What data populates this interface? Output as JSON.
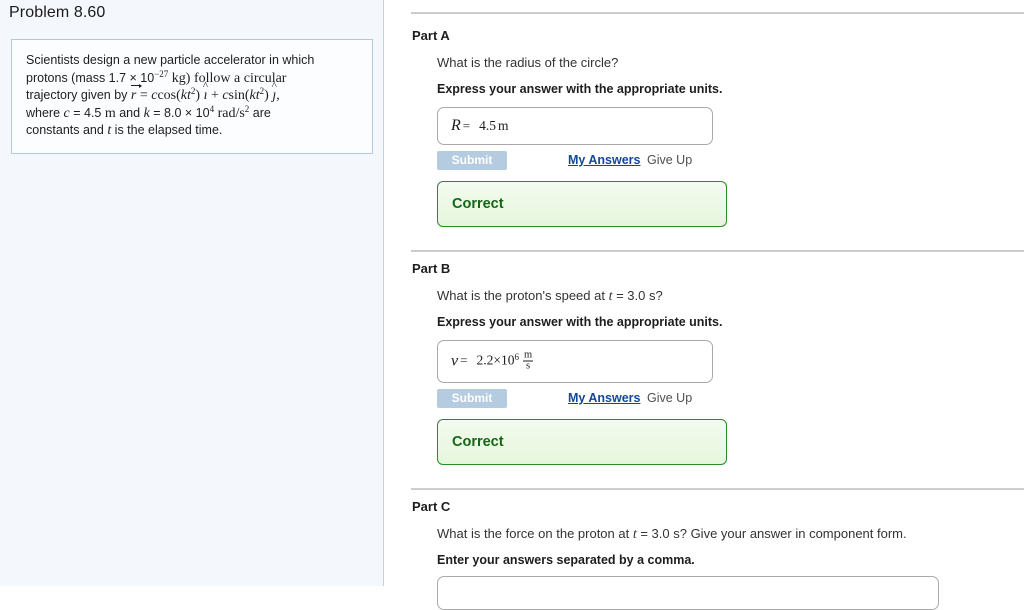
{
  "sidebar": {
    "title": "Problem 8.60",
    "problem_statement": {
      "line1_a": "Scientists design a new particle accelerator in which",
      "line2_a": "protons (mass 1.7 ",
      "times": "×",
      "line2_b": " 10",
      "mass_exponent": "−27",
      "line2_c": " kg) follow a circular",
      "line3_a": "trajectory given by ",
      "r_symbol": "r",
      "equals": "=",
      "c1": "c",
      "cos": "cos(",
      "k1": "k",
      "t1": "t",
      "t1_exp": "2",
      "close1": ")",
      "ihat": "ı",
      "plus": "+",
      "c2": "c",
      "sin": "sin(",
      "k2": "k",
      "t2": "t",
      "t2_exp": "2",
      "close2": ")",
      "jhat": "ȷ",
      "comma": ",",
      "line4_a": "where ",
      "c_sym": "c",
      "c_val": " = 4.5 ",
      "c_unit": "m",
      "and": " and ",
      "k_sym": "k",
      "k_val": " = 8.0 ",
      "k_times": "×",
      "k_pow": " 10",
      "k_exp": "4",
      "k_unit": "rad/s",
      "k_unit_exp": "2",
      "are": " are",
      "line5_a": "constants and ",
      "t_sym": "t",
      "line5_b": " is the elapsed time."
    }
  },
  "parts": [
    {
      "label": "Part A",
      "question_pre": "What is the radius of the circle?",
      "question_var": "",
      "question_post": "",
      "instruction": "Express your answer with the appropriate units.",
      "answer": {
        "variable": "R",
        "equals": "=",
        "value": "4.5",
        "unit": "m",
        "unit_numerator": "",
        "unit_denominator": "",
        "exponent": ""
      },
      "submit_label": "Submit",
      "my_answers_label": "My Answers",
      "give_up_label": "Give Up",
      "status": "Correct"
    },
    {
      "label": "Part B",
      "question_pre": "What is the proton's speed at ",
      "question_var": "t",
      "question_post": " = 3.0 s?",
      "instruction": "Express your answer with the appropriate units.",
      "answer": {
        "variable": "v",
        "equals": "=",
        "value": "2.2×10",
        "exponent": "6",
        "unit": "",
        "unit_numerator": "m",
        "unit_denominator": "s"
      },
      "submit_label": "Submit",
      "my_answers_label": "My Answers",
      "give_up_label": "Give Up",
      "status": "Correct"
    },
    {
      "label": "Part C",
      "question_pre": "What is the force on the proton at ",
      "question_var": "t",
      "question_post": " = 3.0 s? Give your answer in component form.",
      "instruction": "Enter your answers separated by a comma.",
      "answer": {
        "variable": "",
        "equals": "",
        "value": "",
        "unit": "",
        "unit_numerator": "",
        "unit_denominator": "",
        "exponent": ""
      },
      "submit_label": "",
      "my_answers_label": "",
      "give_up_label": "",
      "status": ""
    }
  ],
  "colors": {
    "sidebar_bg": "#f4f8fc",
    "sidebar_border": "#c3d3e0",
    "problem_box_border": "#b5c8d8",
    "submit_bg": "#b4cbe0",
    "link_blue": "#12489c",
    "correct_green_border": "#2b8a2b",
    "correct_green_text": "#156615",
    "divider_gray": "#cdcdcd"
  }
}
